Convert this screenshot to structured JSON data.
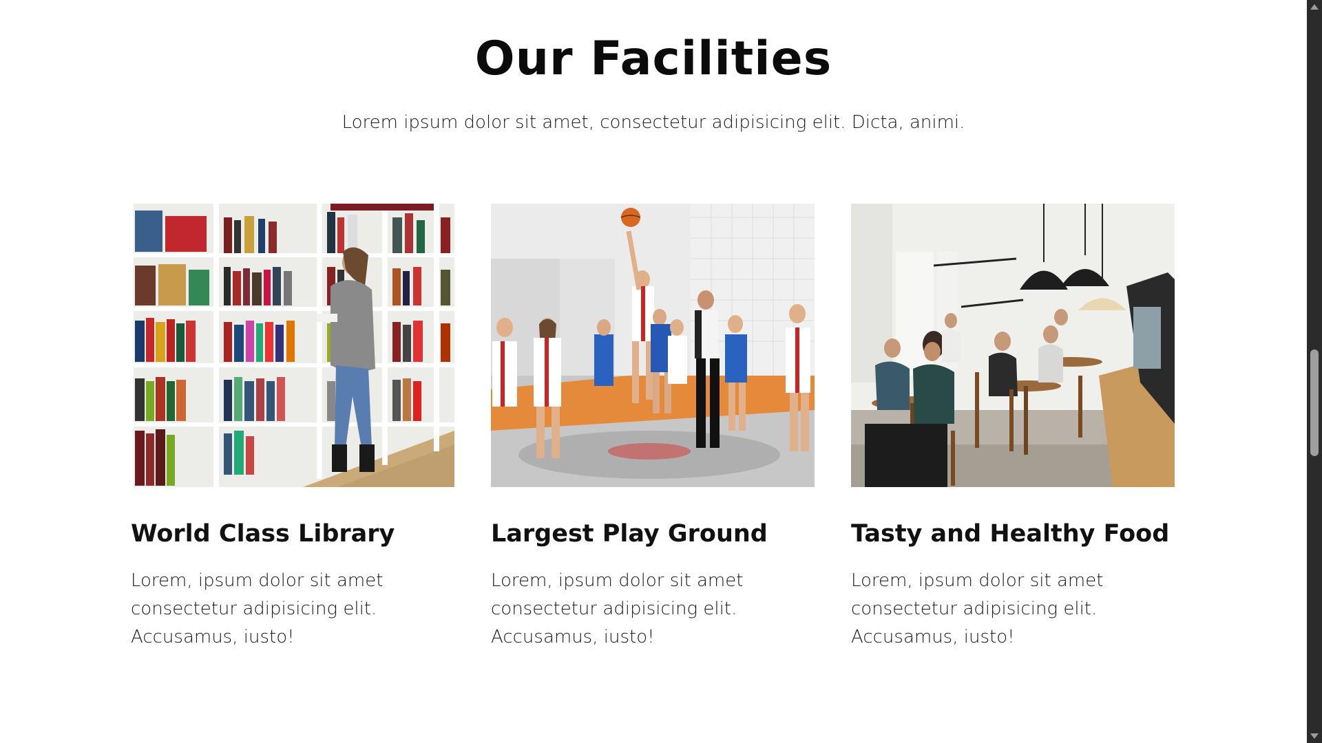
{
  "section": {
    "title": "Our Facilities",
    "subtitle": "Lorem ipsum dolor sit amet, consectetur adipisicing elit. Dicta, animi."
  },
  "cards": [
    {
      "title": "World Class Library",
      "description": "Lorem, ipsum dolor sit amet consectetur adipisicing elit. Accusamus, iusto!",
      "image": "library-photo"
    },
    {
      "title": "Largest Play Ground",
      "description": "Lorem, ipsum dolor sit amet consectetur adipisicing elit. Accusamus, iusto!",
      "image": "basketball-photo"
    },
    {
      "title": "Tasty and Healthy Food",
      "description": "Lorem, ipsum dolor sit amet consectetur adipisicing elit. Accusamus, iusto!",
      "image": "cafe-photo"
    }
  ],
  "colors": {
    "background": "#ffffff",
    "text": "#111111",
    "scrollbar_track": "#2b2b2b",
    "scrollbar_thumb": "#9f9f9f"
  }
}
